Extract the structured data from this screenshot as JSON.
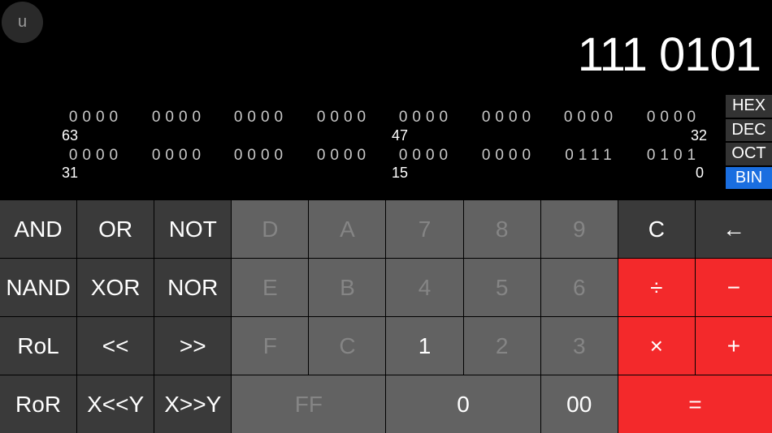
{
  "menu": {
    "label": "u"
  },
  "display": {
    "value": "111 0101"
  },
  "bits": {
    "row_upper": [
      "0000",
      "0000",
      "0000",
      "0000",
      "0000",
      "0000",
      "0000",
      "0000"
    ],
    "row_lower": [
      "0000",
      "0000",
      "0000",
      "0000",
      "0000",
      "0000",
      "0111",
      "0101"
    ],
    "labels": {
      "b63": "63",
      "b47": "47",
      "b32": "32",
      "b31": "31",
      "b15": "15",
      "b0": "0"
    }
  },
  "bases": {
    "hex": "HEX",
    "dec": "DEC",
    "oct": "OCT",
    "bin": "BIN",
    "active": "BIN"
  },
  "keys": {
    "and": "AND",
    "or": "OR",
    "not": "NOT",
    "d": "D",
    "a": "A",
    "seven": "7",
    "eight": "8",
    "nine": "9",
    "clear": "C",
    "backspace": "←",
    "nand": "NAND",
    "xor": "XOR",
    "nor": "NOR",
    "e": "E",
    "b": "B",
    "four": "4",
    "five": "5",
    "six": "6",
    "divide": "÷",
    "minus": "−",
    "rol": "RoL",
    "shl": "<<",
    "shr": ">>",
    "f": "F",
    "c": "C",
    "one": "1",
    "two": "2",
    "three": "3",
    "multiply": "×",
    "plus": "+",
    "ror": "RoR",
    "xshly": "X<<Y",
    "xshry": "X>>Y",
    "ff": "FF",
    "zero": "0",
    "double_zero": "00",
    "equals": "="
  },
  "colors": {
    "accent": "#1a6ee0",
    "operator": "#f3292b"
  }
}
